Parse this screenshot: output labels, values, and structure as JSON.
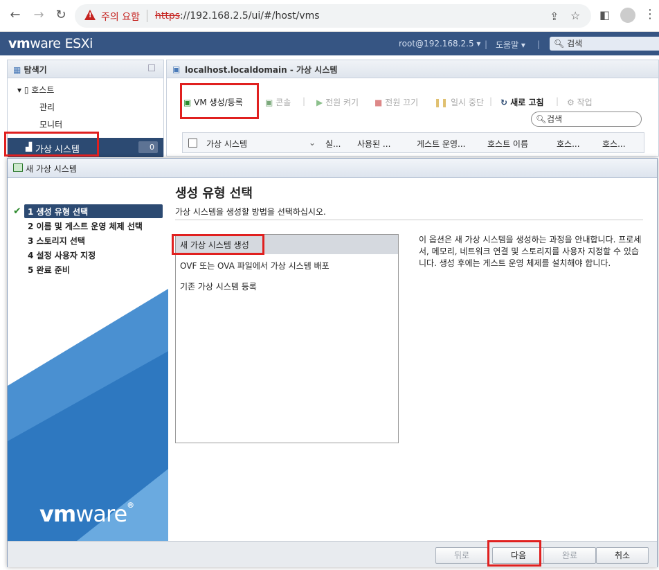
{
  "browser": {
    "security_warning": "주의 요함",
    "url_protocol": "https",
    "url_rest": "://192.168.2.5/ui/#/host/vms"
  },
  "header": {
    "logo_bold": "vm",
    "logo_light": "ware",
    "logo_product": "ESXi",
    "user": "root@192.168.2.5 ▾",
    "help": "도움말 ▾",
    "search_placeholder": "검색"
  },
  "navigator": {
    "title": "탐색기",
    "host": "호스트",
    "manage": "관리",
    "monitor": "모니터",
    "vms": "가상 시스템",
    "vm_count": "0"
  },
  "content": {
    "title": "localhost.localdomain - 가상 시스템",
    "toolbar": {
      "create": "VM 생성/등록",
      "console": "콘솔",
      "power_on": "전원 켜기",
      "power_off": "전원 끄기",
      "suspend": "일시 중단",
      "refresh": "새로 고침",
      "actions": "작업"
    },
    "search_placeholder": "검색",
    "columns": [
      "가상 시스템",
      "실...",
      "사용된 ...",
      "게스트 운영...",
      "호스트 이름",
      "호스...",
      "호스..."
    ]
  },
  "modal": {
    "title": "새 가상 시스템",
    "steps": [
      "1 생성 유형 선택",
      "2 이름 및 게스트 운영 체제 선택",
      "3 스토리지 선택",
      "4 설정 사용자 지정",
      "5 완료 준비"
    ],
    "logo_bold": "vm",
    "logo_light": "ware",
    "heading": "생성 유형 선택",
    "subheading": "가상 시스템을 생성할 방법을 선택하십시오.",
    "options": [
      "새 가상 시스템 생성",
      "OVF 또는 OVA 파일에서 가상 시스템 배포",
      "기존 가상 시스템 등록"
    ],
    "description": "이 옵션은 새 가상 시스템을 생성하는 과정을 안내합니다. 프로세서, 메모리, 네트워크 연결 및 스토리지를 사용자 지정할 수 있습니다. 생성 후에는 게스트 운영 체제를 설치해야 합니다.",
    "buttons": {
      "back": "뒤로",
      "next": "다음",
      "finish": "완료",
      "cancel": "취소"
    }
  },
  "colors": {
    "header_bg": "#365583",
    "selected_bg": "#2c4a72",
    "highlight": "#e0201f"
  }
}
